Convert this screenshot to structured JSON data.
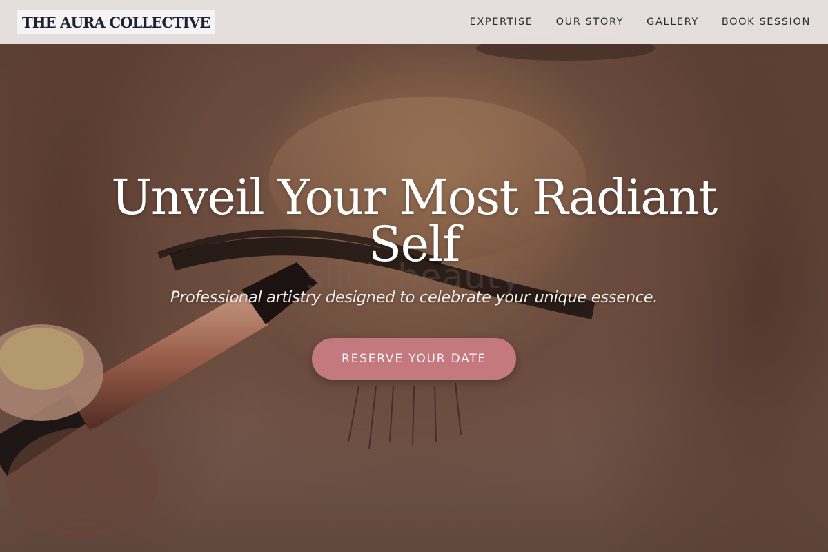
{
  "header": {
    "brand": "THE AURA COLLECTIVE",
    "nav": [
      {
        "label": "EXPERTISE"
      },
      {
        "label": "OUR STORY"
      },
      {
        "label": "GALLERY"
      },
      {
        "label": "BOOK SESSION"
      }
    ]
  },
  "hero": {
    "title": "Unveil Your Most Radiant Self",
    "subtitle": "Professional artistry designed to celebrate your unique essence.",
    "watermark": "slick beauty",
    "cta_label": "RESERVE YOUR DATE",
    "background_icon": "makeup-brush-eye-photo"
  },
  "colors": {
    "header_bg": "#f0ecea",
    "brand_text": "#1b2233",
    "nav_text": "#2c2c33",
    "cta_bg": "#c4797e",
    "hero_text": "#ffffff"
  }
}
